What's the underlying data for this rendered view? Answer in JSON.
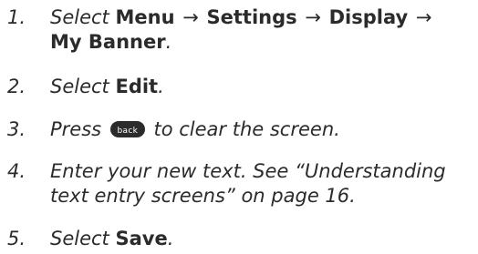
{
  "steps": [
    {
      "number": "1.",
      "pre": "Select",
      "menu1": "Menu",
      "arrow1": "→",
      "menu2": "Settings",
      "arrow2": "→",
      "menu3": "Display",
      "arrow3": "→",
      "menu4": "My Banner",
      "end": "."
    },
    {
      "number": "2.",
      "pre": "Select",
      "bold": "Edit",
      "end": "."
    },
    {
      "number": "3.",
      "pre": "Press",
      "key": "back",
      "post": "to clear the screen."
    },
    {
      "number": "4.",
      "text": "Enter your new text. See “Understanding text entry screens” on page 16."
    },
    {
      "number": "5.",
      "pre": "Select",
      "bold": "Save",
      "end": "."
    }
  ],
  "icons": {
    "back_key": "back-key-icon"
  }
}
